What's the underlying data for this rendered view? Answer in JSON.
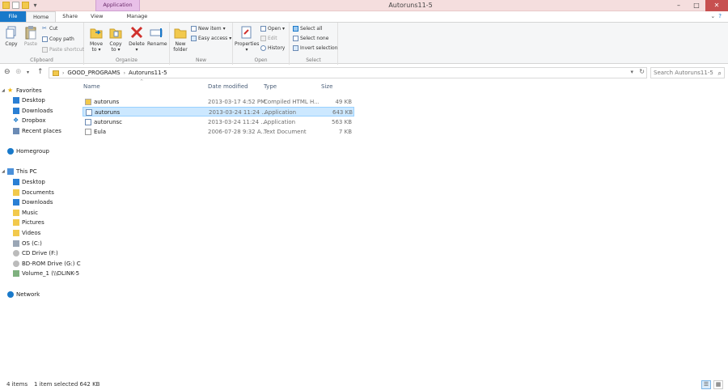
{
  "window": {
    "title": "Autoruns11-5",
    "context_tab": "Application Tools",
    "controls": [
      "–",
      "□",
      "✕"
    ]
  },
  "tabs": {
    "file": "File",
    "home": "Home",
    "share": "Share",
    "view": "View",
    "manage": "Manage"
  },
  "ribbon": {
    "clipboard": {
      "label": "Clipboard",
      "copy": "Copy",
      "paste": "Paste",
      "cut": "Cut",
      "copy_path": "Copy path",
      "paste_shortcut": "Paste shortcut"
    },
    "organize": {
      "label": "Organize",
      "move_to": "Move",
      "move_to_2": "to",
      "copy_to": "Copy",
      "copy_to_2": "to",
      "delete": "Delete",
      "rename": "Rename"
    },
    "new": {
      "label": "New",
      "new_folder": "New",
      "new_folder_2": "folder",
      "new_item": "New item",
      "easy_access": "Easy access"
    },
    "open": {
      "label": "Open",
      "properties": "Properties",
      "open": "Open",
      "edit": "Edit",
      "history": "History"
    },
    "select": {
      "label": "Select",
      "select_all": "Select all",
      "select_none": "Select none",
      "invert_selection": "Invert selection"
    }
  },
  "address": {
    "crumbs": [
      "GOOD_PROGRAMS",
      "Autoruns11-5"
    ],
    "search_placeholder": "Search Autoruns11-5"
  },
  "nav": {
    "favorites": "Favorites",
    "fav_items": [
      "Desktop",
      "Downloads",
      "Dropbox",
      "Recent places"
    ],
    "homegroup": "Homegroup",
    "this_pc": "This PC",
    "pc_items": [
      "Desktop",
      "Documents",
      "Downloads",
      "Music",
      "Pictures",
      "Videos",
      "OS (C:)",
      "CD Drive (F:)",
      "BD-ROM Drive (G:) C",
      "Volume_1 (\\\\DLINK-5"
    ],
    "network": "Network"
  },
  "columns": {
    "name": "Name",
    "date": "Date modified",
    "type": "Type",
    "size": "Size"
  },
  "files": [
    {
      "name": "autoruns",
      "date": "2013-03-17 4:52 PM",
      "type": "Compiled HTML H...",
      "size": "49 KB",
      "icon": "chm-icon"
    },
    {
      "name": "autoruns",
      "date": "2013-03-24 11:24 ...",
      "type": "Application",
      "size": "643 KB",
      "icon": "app-icon"
    },
    {
      "name": "autorunsc",
      "date": "2013-03-24 11:24 ...",
      "type": "Application",
      "size": "563 KB",
      "icon": "app-icon"
    },
    {
      "name": "Eula",
      "date": "2006-07-28 9:32 A...",
      "type": "Text Document",
      "size": "7 KB",
      "icon": "text-icon"
    }
  ],
  "status": {
    "count": "4 items",
    "selected": "1 item selected  642 KB"
  },
  "colors": {
    "file_tab": "#1979ca",
    "selection": "#cce8ff",
    "title_bar": "#f5dede",
    "close_button": "#c75050"
  }
}
